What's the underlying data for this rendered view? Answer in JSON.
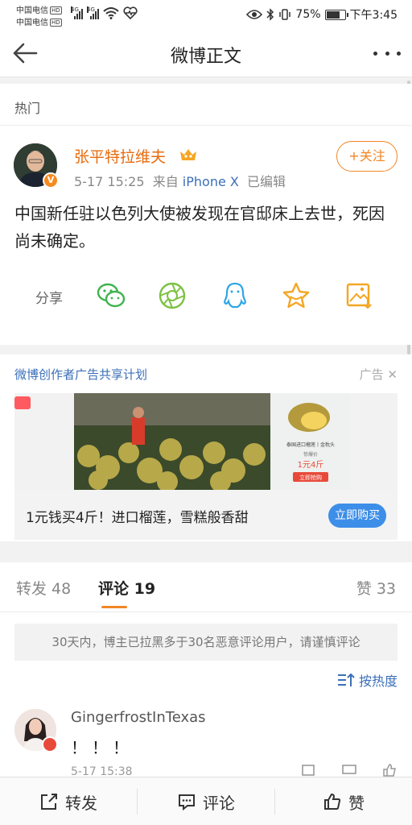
{
  "status_bar": {
    "carrier1": "中国电信",
    "carrier2": "中国电信",
    "hd": "HD",
    "network": "4G",
    "battery": "75%",
    "battery_level": 0.75,
    "time": "下午3:45"
  },
  "nav": {
    "title": "微博正文"
  },
  "hot_label": "热门",
  "post": {
    "username": "张平特拉维夫",
    "time": "5-17 15:25",
    "source_prefix": "来自",
    "source": "iPhone X",
    "edited": "已编辑",
    "follow_label": "+关注",
    "text": "中国新任驻以色列大使被发现在官邸床上去世，死因尚未确定。",
    "share_label": "分享",
    "icons": [
      "wechat-icon",
      "moments-icon",
      "qq-icon",
      "favorite-icon",
      "save-image-icon"
    ]
  },
  "ad": {
    "program_link": "微博创作者广告共享计划",
    "ad_tag": "广告",
    "caption": "1元钱买4斤！进口榴莲，雪糕般香甜",
    "buy_label": "立即购买",
    "banner_title": "泰国进口榴莲丨金枕头",
    "banner_price_label": "惊爆价",
    "banner_price": "1元4斤",
    "banner_cta": "立即抢购"
  },
  "tabs": {
    "repost": "转发 48",
    "comment": "评论 19",
    "like": "赞 33"
  },
  "comments": {
    "notice": "30天内，博主已拉黑多于30名恶意评论用户，请谨慎评论",
    "sort_label": "按热度",
    "items": [
      {
        "user": "GingerfrostInTexas",
        "text": "！！！",
        "time": "5-17 15:38"
      }
    ]
  },
  "bottom_bar": {
    "repost": "转发",
    "comment": "评论",
    "like": "赞"
  },
  "colors": {
    "accent": "#f18624",
    "link": "#3b6fb8",
    "buy": "#3d8ee8"
  }
}
